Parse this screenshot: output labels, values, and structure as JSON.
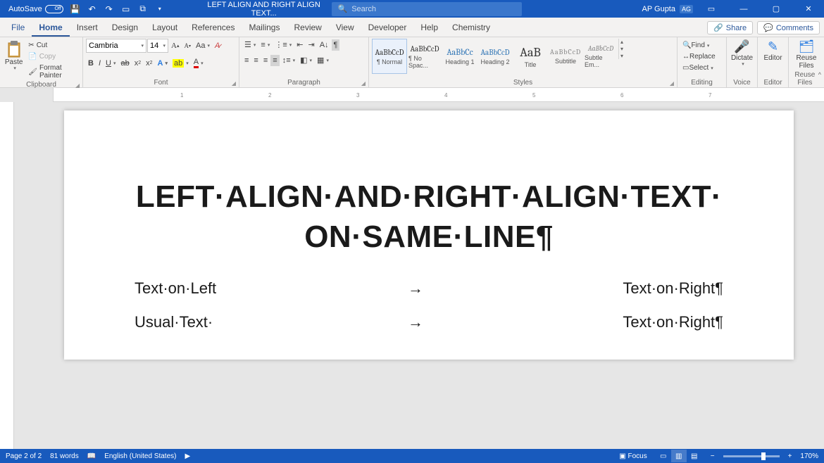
{
  "title_bar": {
    "autosave_label": "AutoSave",
    "autosave_state": "Off",
    "doc_title": "LEFT ALIGN AND RIGHT ALIGN TEXT...",
    "search_placeholder": "Search",
    "user_name": "AP Gupta",
    "user_initials": "AG"
  },
  "tabs": {
    "file": "File",
    "home": "Home",
    "insert": "Insert",
    "design": "Design",
    "layout": "Layout",
    "references": "References",
    "mailings": "Mailings",
    "review": "Review",
    "view": "View",
    "developer": "Developer",
    "help": "Help",
    "chemistry": "Chemistry",
    "share": "Share",
    "comments": "Comments"
  },
  "ribbon": {
    "clipboard": {
      "paste": "Paste",
      "cut": "Cut",
      "copy": "Copy",
      "format_painter": "Format Painter",
      "label": "Clipboard"
    },
    "font": {
      "name": "Cambria",
      "size": "14",
      "label": "Font"
    },
    "paragraph": {
      "label": "Paragraph"
    },
    "styles": {
      "label": "Styles",
      "items": [
        {
          "preview": "AaBbCcD",
          "name": "¶ Normal",
          "selected": true
        },
        {
          "preview": "AaBbCcD",
          "name": "¶ No Spac..."
        },
        {
          "preview": "AaBbCc",
          "name": "Heading 1"
        },
        {
          "preview": "AaBbCcD",
          "name": "Heading 2"
        },
        {
          "preview": "AaB",
          "name": "Title"
        },
        {
          "preview": "AaBbCcD",
          "name": "Subtitle"
        },
        {
          "preview": "AaBbCcD",
          "name": "Subtle Em..."
        }
      ]
    },
    "editing": {
      "find": "Find",
      "replace": "Replace",
      "select": "Select",
      "label": "Editing"
    },
    "voice": {
      "dictate": "Dictate",
      "label": "Voice"
    },
    "editor": {
      "btn": "Editor",
      "label": "Editor"
    },
    "reuse": {
      "btn": "Reuse Files",
      "label": "Reuse Files"
    }
  },
  "document": {
    "heading_l1": "LEFT·ALIGN·AND·RIGHT·ALIGN·TEXT·",
    "heading_l2": "ON·SAME·LINE¶",
    "rows": [
      {
        "left": "Text·on·Left",
        "arrow": "→",
        "right": "Text·on·Right¶"
      },
      {
        "left": "Usual·Text·",
        "arrow": "→",
        "right": "Text·on·Right¶"
      }
    ]
  },
  "status": {
    "page": "Page 2 of 2",
    "words": "81 words",
    "lang": "English (United States)",
    "focus": "Focus",
    "zoom": "170%"
  },
  "ruler_ticks": [
    "1",
    "2",
    "3",
    "4",
    "5",
    "6",
    "7"
  ]
}
